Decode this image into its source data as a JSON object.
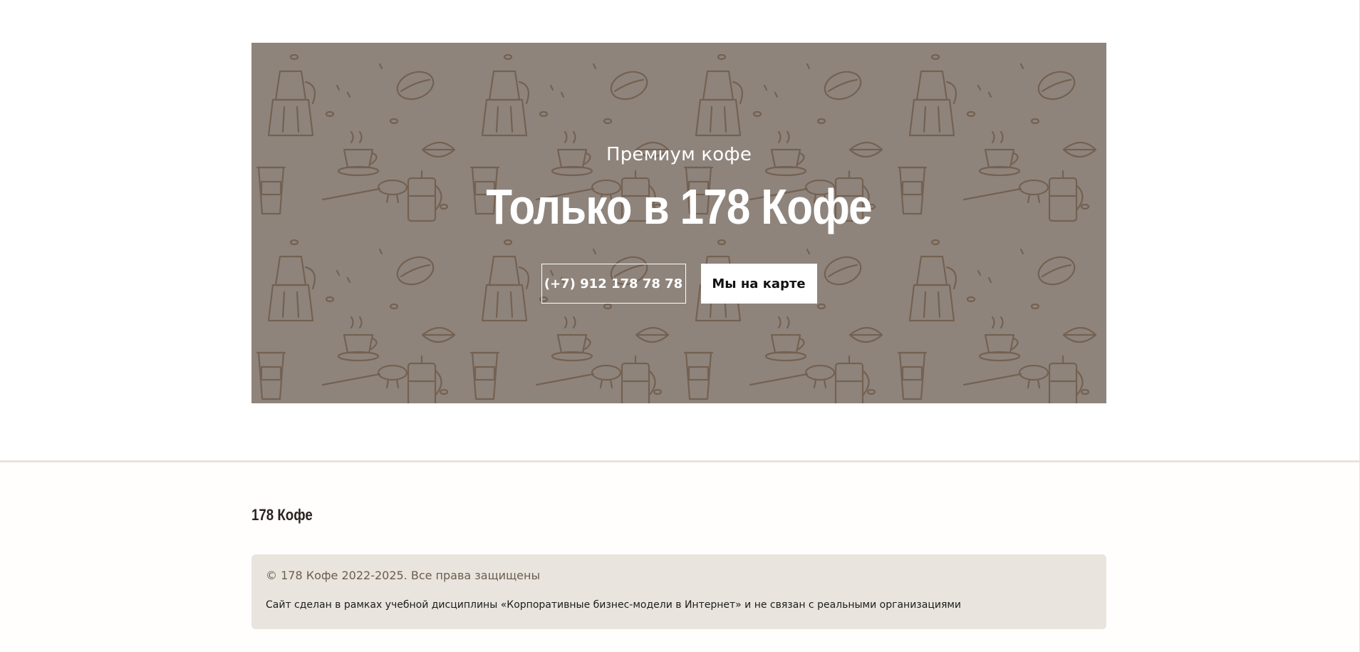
{
  "hero": {
    "subtitle": "Премиум кофе",
    "title": "Только в 178 Кофе",
    "phone_button": "(+7) 912 178 78 78",
    "map_button": "Мы на карте",
    "background_color": "#8e847c",
    "pattern_color": "#6f5a4a"
  },
  "footer": {
    "logo": "178 Кофе",
    "copyright": "© 178 Кофе 2022-2025. Все права защищены",
    "disclaimer": "Сайт сделан в рамках учебной дисциплины «Корпоративные бизнес-модели в Интернет» и не связан с реальными организациями",
    "box_color": "#e9e4dd"
  },
  "icons": [
    "coffee-pattern"
  ]
}
